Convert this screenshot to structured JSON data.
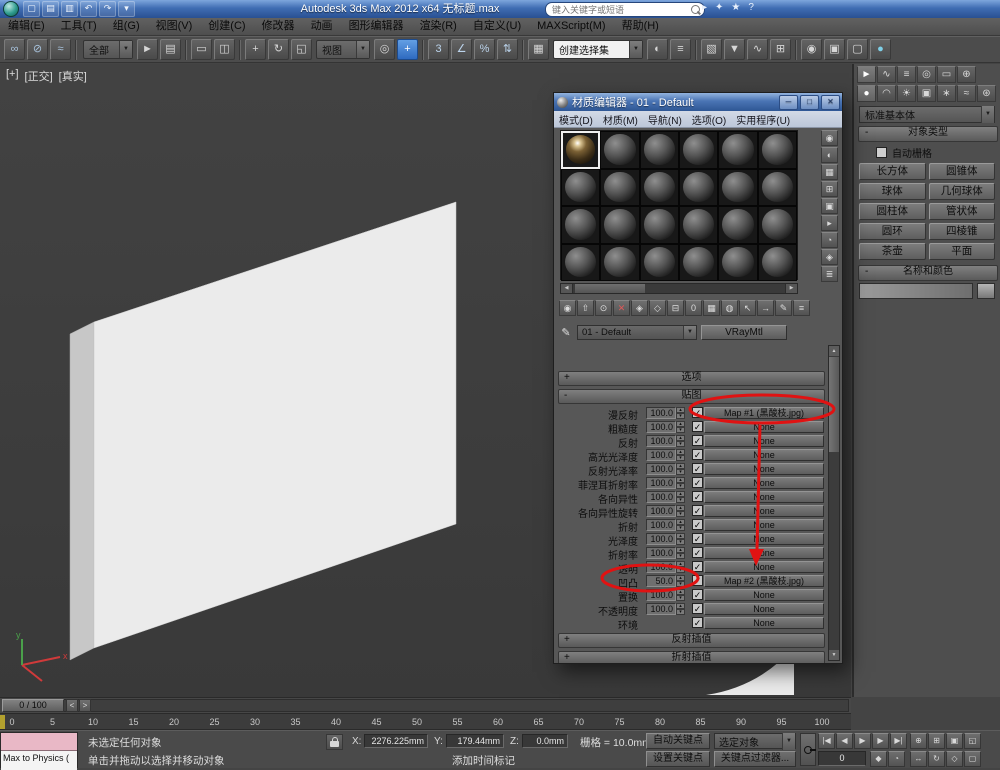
{
  "ui": {
    "chevron_down": "▼",
    "check": "✓",
    "spin_up": "▴",
    "spin_down": "▾",
    "plus": "+",
    "minus": "-",
    "scroll_up": "▲",
    "scroll_down": "▼",
    "left_arrow": "◀",
    "right_arrow": "▶",
    "minimize": "─",
    "maximize": "□",
    "close": "✕",
    "prev": "<",
    "next": ">"
  },
  "window": {
    "title": "Autodesk 3ds Max 2012 x64 无标题.max",
    "search_placeholder": "键入关键字或短语",
    "quick_access_icons": [
      {
        "n": "new-file-icon",
        "g": "▢"
      },
      {
        "n": "open-file-icon",
        "g": "▤"
      },
      {
        "n": "save-file-icon",
        "g": "▥"
      },
      {
        "n": "undo-icon",
        "g": "↶"
      },
      {
        "n": "redo-icon",
        "g": "↷"
      },
      {
        "n": "quick-access-dropdown-icon",
        "g": "▾"
      }
    ],
    "infocenter_icons": [
      {
        "n": "search-go-icon",
        "g": "▸"
      },
      {
        "n": "communication-center-icon",
        "g": "✦"
      },
      {
        "n": "favorites-icon",
        "g": "★"
      },
      {
        "n": "help-icon",
        "g": "?"
      }
    ]
  },
  "menu_bar": [
    "编辑(E)",
    "工具(T)",
    "组(G)",
    "视图(V)",
    "创建(C)",
    "修改器",
    "动画",
    "图形编辑器",
    "渲染(R)",
    "自定义(U)",
    "MAXScript(M)",
    "帮助(H)"
  ],
  "toolbar": {
    "items": [
      {
        "t": "i",
        "n": "select-and-link-icon",
        "g": "∞",
        "tint": "#a9c4de"
      },
      {
        "t": "i",
        "n": "unlink-selection-icon",
        "g": "⊘",
        "tint": "#a9c4de"
      },
      {
        "t": "i",
        "n": "bind-to-space-warp-icon",
        "g": "≈",
        "tint": "#a9c4de"
      },
      {
        "t": "s"
      },
      {
        "t": "c",
        "n": "selection-filter-dropdown",
        "v": "全部",
        "w": 50
      },
      {
        "t": "i",
        "n": "select-object-icon",
        "g": "►"
      },
      {
        "t": "i",
        "n": "select-by-name-icon",
        "g": "▤"
      },
      {
        "t": "s"
      },
      {
        "t": "i",
        "n": "rectangular-selection-region-icon",
        "g": "▭"
      },
      {
        "t": "i",
        "n": "window-crossing-icon",
        "g": "◫"
      },
      {
        "t": "s"
      },
      {
        "t": "i",
        "n": "select-and-move-icon",
        "g": "+"
      },
      {
        "t": "i",
        "n": "select-and-rotate-icon",
        "g": "↻"
      },
      {
        "t": "i",
        "n": "select-and-scale-icon",
        "g": "◱"
      },
      {
        "t": "c",
        "n": "reference-coordinate-dropdown",
        "v": "视图",
        "w": 54
      },
      {
        "t": "i",
        "n": "use-pivot-point-icon",
        "g": "◎"
      },
      {
        "t": "i",
        "n": "select-and-manipulate-icon",
        "g": "+",
        "active": true
      },
      {
        "t": "s"
      },
      {
        "t": "i",
        "n": "snaps-toggle-icon",
        "g": "3",
        "tint": "#bcd4ec"
      },
      {
        "t": "i",
        "n": "angle-snap-icon",
        "g": "∠",
        "tint": "#bcd4ec"
      },
      {
        "t": "i",
        "n": "percent-snap-icon",
        "g": "%",
        "tint": "#bcd4ec"
      },
      {
        "t": "i",
        "n": "spinner-snap-icon",
        "g": "⇅",
        "tint": "#bcd4ec"
      },
      {
        "t": "s"
      },
      {
        "t": "i",
        "n": "edit-named-selection-sets-icon",
        "g": "▦"
      },
      {
        "t": "c",
        "n": "named-selection-sets-dropdown",
        "v": "创建选择集",
        "w": 90,
        "light": true
      },
      {
        "t": "i",
        "n": "mirror-icon",
        "g": "◐"
      },
      {
        "t": "i",
        "n": "align-icon",
        "g": "≡"
      },
      {
        "t": "s"
      },
      {
        "t": "i",
        "n": "layer-manager-icon",
        "g": "▧"
      },
      {
        "t": "i",
        "n": "graphite-ribbon-icon",
        "g": "▼"
      },
      {
        "t": "i",
        "n": "curve-editor-icon",
        "g": "∿"
      },
      {
        "t": "i",
        "n": "schematic-view-icon",
        "g": "⊞"
      },
      {
        "t": "s"
      },
      {
        "t": "i",
        "n": "material-editor-icon",
        "g": "◉"
      },
      {
        "t": "i",
        "n": "render-setup-icon",
        "g": "▣"
      },
      {
        "t": "i",
        "n": "rendered-frame-icon",
        "g": "▢"
      },
      {
        "t": "i",
        "n": "render-production-icon",
        "g": "●",
        "tint": "#7fd0e8"
      }
    ]
  },
  "viewport": {
    "labels": [
      "[+]",
      "[正交]",
      "[真实]"
    ]
  },
  "material_editor": {
    "title": "材质编辑器 - 01 - Default",
    "menus": [
      "模式(D)",
      "材质(M)",
      "导航(N)",
      "选项(O)",
      "实用程序(U)"
    ],
    "sample_slot_count": 24,
    "active_slot": 0,
    "side_icons": [
      {
        "n": "sample-type-icon",
        "g": "◉"
      },
      {
        "n": "backlight-icon",
        "g": "◐"
      },
      {
        "n": "background-icon",
        "g": "▦"
      },
      {
        "n": "sample-tiling-icon",
        "g": "⊞"
      },
      {
        "n": "video-color-check-icon",
        "g": "▣"
      },
      {
        "n": "make-preview-icon",
        "g": "▸"
      },
      {
        "n": "options-icon",
        "g": "◔"
      },
      {
        "n": "select-by-material-icon",
        "g": "◈"
      },
      {
        "n": "material-map-navigator-icon",
        "g": "≣"
      }
    ],
    "toolbar_icons": [
      {
        "n": "get-material-icon",
        "g": "◉"
      },
      {
        "n": "put-material-to-scene-icon",
        "g": "⇧"
      },
      {
        "n": "assign-material-to-selection-icon",
        "g": "⊙"
      },
      {
        "n": "reset-map-icon",
        "g": "✕",
        "tint": "#e05a5a"
      },
      {
        "n": "make-material-copy-icon",
        "g": "◈"
      },
      {
        "n": "make-unique-icon",
        "g": "◇"
      },
      {
        "n": "put-to-library-icon",
        "g": "⊟"
      },
      {
        "n": "material-id-channel-icon",
        "g": "0"
      },
      {
        "n": "show-map-in-viewport-icon",
        "g": "▦"
      },
      {
        "n": "show-end-result-icon",
        "g": "◍"
      },
      {
        "n": "go-to-parent-icon",
        "g": "↖"
      },
      {
        "n": "go-forward-sibling-icon",
        "g": "→"
      },
      {
        "n": "pick-from-object-icon",
        "g": "✎"
      },
      {
        "n": "material-map-browser-icon",
        "g": "≡"
      }
    ],
    "material_name": "01 - Default",
    "material_type": "VRayMtl",
    "rollouts": {
      "options": "选项",
      "maps": "贴图",
      "reflect_interpolation": "反射插值",
      "refract_interpolation": "折射插值"
    },
    "maps": [
      {
        "label": "漫反射",
        "amount": "100.0",
        "map": "Map #1 (黑酸枝.jpg)"
      },
      {
        "label": "粗糙度",
        "amount": "100.0",
        "map": "None"
      },
      {
        "label": "反射",
        "amount": "100.0",
        "map": "None"
      },
      {
        "label": "高光光泽度",
        "amount": "100.0",
        "map": "None"
      },
      {
        "label": "反射光泽率",
        "amount": "100.0",
        "map": "None"
      },
      {
        "label": "菲涅耳折射率",
        "amount": "100.0",
        "map": "None"
      },
      {
        "label": "各向异性",
        "amount": "100.0",
        "map": "None"
      },
      {
        "label": "各向异性旋转",
        "amount": "100.0",
        "map": "None"
      },
      {
        "label": "折射",
        "amount": "100.0",
        "map": "None"
      },
      {
        "label": "光泽度",
        "amount": "100.0",
        "map": "None"
      },
      {
        "label": "折射率",
        "amount": "100.0",
        "map": "None"
      },
      {
        "label": "透明",
        "amount": "100.0",
        "map": "None"
      },
      {
        "label": "凹凸",
        "amount": "50.0",
        "map": "Map #2 (黑酸枝.jpg)"
      },
      {
        "label": "置换",
        "amount": "100.0",
        "map": "None"
      },
      {
        "label": "不透明度",
        "amount": "100.0",
        "map": "None"
      },
      {
        "label": "环境",
        "amount": "",
        "map": "None"
      }
    ]
  },
  "command_panel": {
    "tab_icons": [
      {
        "n": "create-tab-icon",
        "g": "►",
        "active": true
      },
      {
        "n": "modify-tab-icon",
        "g": "∿"
      },
      {
        "n": "hierarchy-tab-icon",
        "g": "≡"
      },
      {
        "n": "motion-tab-icon",
        "g": "◎"
      },
      {
        "n": "display-tab-icon",
        "g": "▭"
      },
      {
        "n": "utilities-tab-icon",
        "g": "⊕"
      }
    ],
    "category_icons": [
      {
        "n": "geometry-category-icon",
        "g": "●",
        "active": true
      },
      {
        "n": "shapes-category-icon",
        "g": "◠"
      },
      {
        "n": "lights-category-icon",
        "g": "☀"
      },
      {
        "n": "cameras-category-icon",
        "g": "▣"
      },
      {
        "n": "helpers-category-icon",
        "g": "∗"
      },
      {
        "n": "space-warps-category-icon",
        "g": "≈"
      },
      {
        "n": "systems-category-icon",
        "g": "⊛"
      }
    ],
    "category_dropdown": "标准基本体",
    "object_type_rollout": "对象类型",
    "autogrid_label": "自动栅格",
    "object_buttons": [
      "长方体",
      "圆锥体",
      "球体",
      "几何球体",
      "圆柱体",
      "管状体",
      "圆环",
      "四棱锥",
      "茶壶",
      "平面"
    ],
    "name_color_rollout": "名称和颜色"
  },
  "timeline": {
    "slider_label": "0 / 100",
    "tick_step": 5,
    "tick_max": 100
  },
  "status_bar": {
    "listener_text": "Max to Physics (",
    "selection_status": "未选定任何对象",
    "prompt": "单击并拖动以选择并移动对象",
    "coords": {
      "x_label": "X:",
      "x": "2276.225mm",
      "y_label": "Y:",
      "y": "179.44mm",
      "z_label": "Z:",
      "z": "0.0mm"
    },
    "grid_label": "栅格 = 10.0mm",
    "time_tag": "添加时间标记",
    "auto_key": "自动关键点",
    "set_key": "设置关键点",
    "selection_set": "选定对象",
    "key_filters": "关键点过滤器...",
    "frame": "0",
    "playback_icons": [
      {
        "n": "go-to-start-button",
        "g": "|◀"
      },
      {
        "n": "previous-frame-button",
        "g": "◀"
      },
      {
        "n": "play-animation-button",
        "g": "▶"
      },
      {
        "n": "next-frame-button",
        "g": "▶"
      },
      {
        "n": "go-to-end-button",
        "g": "▶|"
      }
    ],
    "time_icons": [
      {
        "n": "key-mode-toggle-icon",
        "g": "◆"
      },
      {
        "n": "time-configuration-icon",
        "g": "◔"
      }
    ],
    "nav_icons_row1": [
      {
        "n": "zoom-icon",
        "g": "⊕"
      },
      {
        "n": "zoom-all-icon",
        "g": "⊞"
      },
      {
        "n": "zoom-extents-icon",
        "g": "▣"
      },
      {
        "n": "zoom-region-icon",
        "g": "◱"
      }
    ],
    "nav_icons_row2": [
      {
        "n": "pan-icon",
        "g": "↔"
      },
      {
        "n": "orbit-icon",
        "g": "↻"
      },
      {
        "n": "fov-icon",
        "g": "◇"
      },
      {
        "n": "maximize-viewport-icon",
        "g": "▢"
      }
    ]
  }
}
